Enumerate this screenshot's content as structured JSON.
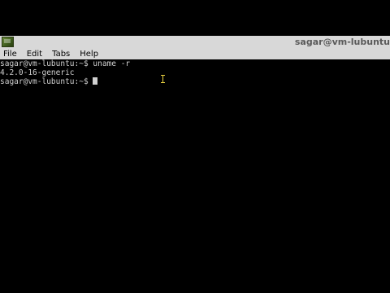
{
  "window": {
    "title": "sagar@vm-lubuntu"
  },
  "menubar": {
    "items": [
      {
        "label": "File"
      },
      {
        "label": "Edit"
      },
      {
        "label": "Tabs"
      },
      {
        "label": "Help"
      }
    ]
  },
  "terminal": {
    "lines": [
      {
        "prompt": "sagar@vm-lubuntu:~$ ",
        "text": "uname -r"
      },
      {
        "prompt": "",
        "text": "4.2.0-16-generic"
      },
      {
        "prompt": "sagar@vm-lubuntu:~$ ",
        "text": ""
      }
    ]
  },
  "colors": {
    "background": "#000000",
    "text": "#d0d0d0",
    "chrome": "#d8d8d8",
    "mouse_cursor": "#e8d040"
  },
  "icons": {
    "app": "terminal-app-icon",
    "text_cursor": "block-cursor",
    "mouse_pointer": "i-beam-pointer-icon"
  }
}
